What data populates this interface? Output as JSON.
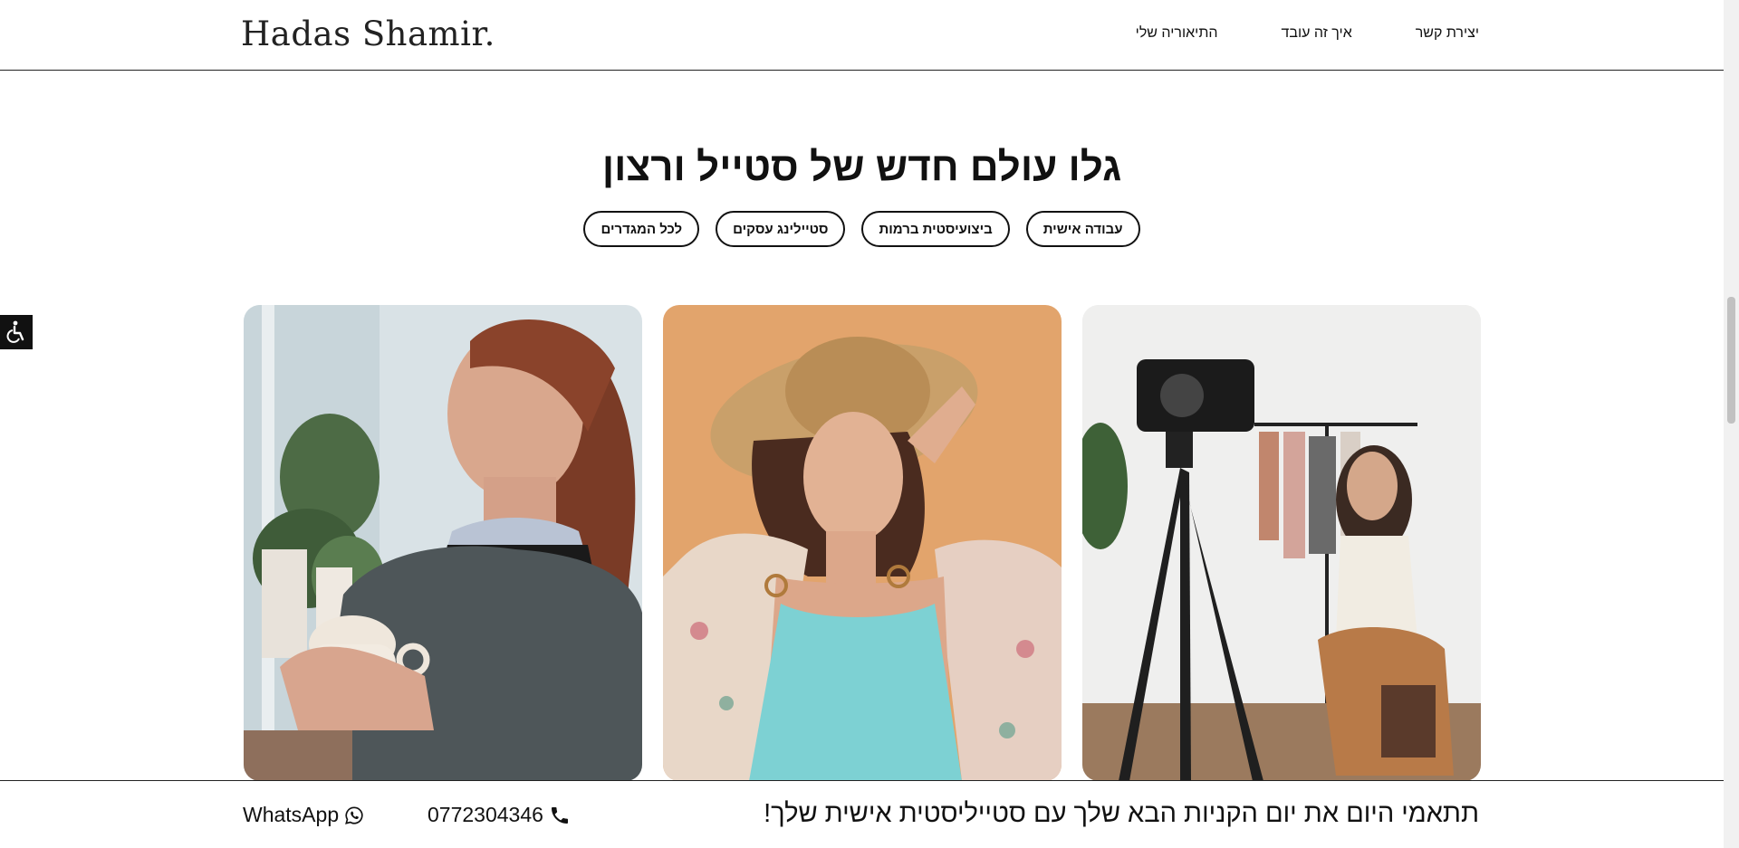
{
  "header": {
    "logo": "Hadas Shamir.",
    "nav": [
      {
        "label": "התיאוריה שלי"
      },
      {
        "label": "איך זה עובד"
      },
      {
        "label": "יצירת קשר"
      }
    ]
  },
  "hero": {
    "title": "גלו עולם חדש של סטייל ורצון",
    "filters": [
      {
        "label": "עבודה אישית"
      },
      {
        "label": "ביצועיסטית ברמות"
      },
      {
        "label": "סטיילינג עסקים"
      },
      {
        "label": "לכל המגדרים"
      }
    ]
  },
  "cards": [
    {
      "name": "woman-with-camera-tripod"
    },
    {
      "name": "woman-in-straw-hat"
    },
    {
      "name": "woman-holding-coffee-cup"
    }
  ],
  "footer": {
    "promo": "תתאמי היום את יום הקניות הבא שלך עם סטייליסטית אישית שלך!",
    "phone": "0772304346",
    "whatsapp": "WhatsApp"
  },
  "colors": {
    "text": "#111111",
    "background": "#ffffff",
    "accent_dark": "#111111"
  },
  "icons": [
    "accessibility-icon",
    "phone-icon",
    "whatsapp-icon"
  ]
}
